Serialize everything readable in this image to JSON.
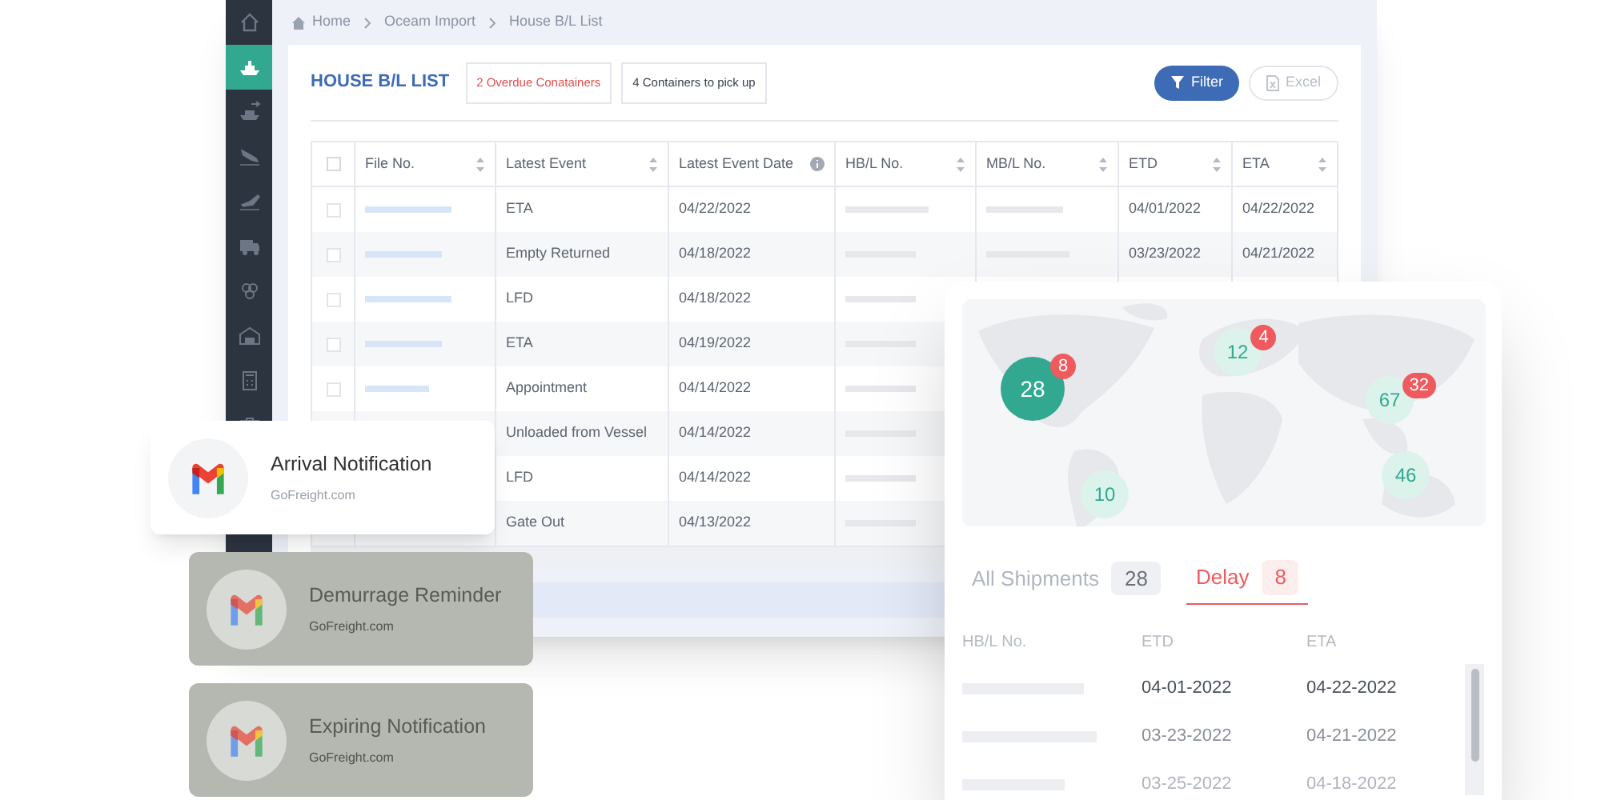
{
  "sidebar": {
    "items": [
      {
        "selected": false
      },
      {
        "selected": true
      },
      {
        "selected": false
      },
      {
        "selected": false
      },
      {
        "selected": false
      },
      {
        "selected": false
      },
      {
        "selected": false
      },
      {
        "selected": false
      },
      {
        "selected": false
      },
      {
        "selected": false
      }
    ]
  },
  "breadcrumb": [
    "Home",
    "Oceam Import",
    "House B/L List"
  ],
  "list": {
    "title": "HOUSE B/L LIST",
    "badges": [
      {
        "text": "2 Overdue Conatainers",
        "kind": "alert"
      },
      {
        "text": "4 Containers to pick up",
        "kind": "plain"
      }
    ],
    "filter_button": "Filter",
    "excel_button": "Excel",
    "select_all_checked": false,
    "columns": [
      "File No.",
      "Latest Event",
      "Latest Event Date",
      "HB/L No.",
      "MB/L No.",
      "ETD",
      "ETA"
    ],
    "rows": [
      {
        "checked": false,
        "event": "ETA",
        "event_date": "04/22/2022",
        "etd": "04/01/2022",
        "eta": "04/22/2022"
      },
      {
        "checked": false,
        "event": "Empty Returned",
        "event_date": "04/18/2022",
        "etd": "03/23/2022",
        "eta": "04/21/2022"
      },
      {
        "checked": false,
        "event": "LFD",
        "event_date": "04/18/2022"
      },
      {
        "checked": false,
        "event": "ETA",
        "event_date": "04/19/2022"
      },
      {
        "checked": false,
        "event": "Appointment",
        "event_date": "04/14/2022"
      },
      {
        "event": "Unloaded from Vessel",
        "event_date": "04/14/2022"
      },
      {
        "event": "LFD",
        "event_date": "04/14/2022"
      },
      {
        "event": "Gate Out",
        "event_date": "04/13/2022"
      }
    ]
  },
  "notifications": [
    {
      "title": "Arrival Notification",
      "source": "GoFreight.com",
      "faded": false
    },
    {
      "title": "Demurrage Reminder",
      "source": "GoFreight.com",
      "faded": true
    },
    {
      "title": "Expiring Notification",
      "source": "GoFreight.com",
      "faded": true
    }
  ],
  "map_panel": {
    "clusters": [
      {
        "count": "28",
        "delay": "8",
        "highlighted": true
      },
      {
        "count": "12",
        "delay": "4",
        "highlighted": false
      },
      {
        "count": "67",
        "delay": "32",
        "highlighted": false
      },
      {
        "count": "46",
        "highlighted": false
      },
      {
        "count": "10",
        "highlighted": false
      }
    ],
    "tabs": [
      {
        "label": "All Shipments",
        "count": "28",
        "selected": false
      },
      {
        "label": "Delay",
        "count": "8",
        "selected": true
      }
    ],
    "columns": [
      "HB/L No.",
      "ETD",
      "ETA"
    ],
    "rows": [
      {
        "etd": "04-01-2022",
        "eta": "04-22-2022",
        "faded": false
      },
      {
        "etd": "03-23-2022",
        "eta": "04-21-2022",
        "faded": false
      },
      {
        "etd": "03-25-2022",
        "eta": "04-18-2022",
        "faded": true
      }
    ]
  }
}
